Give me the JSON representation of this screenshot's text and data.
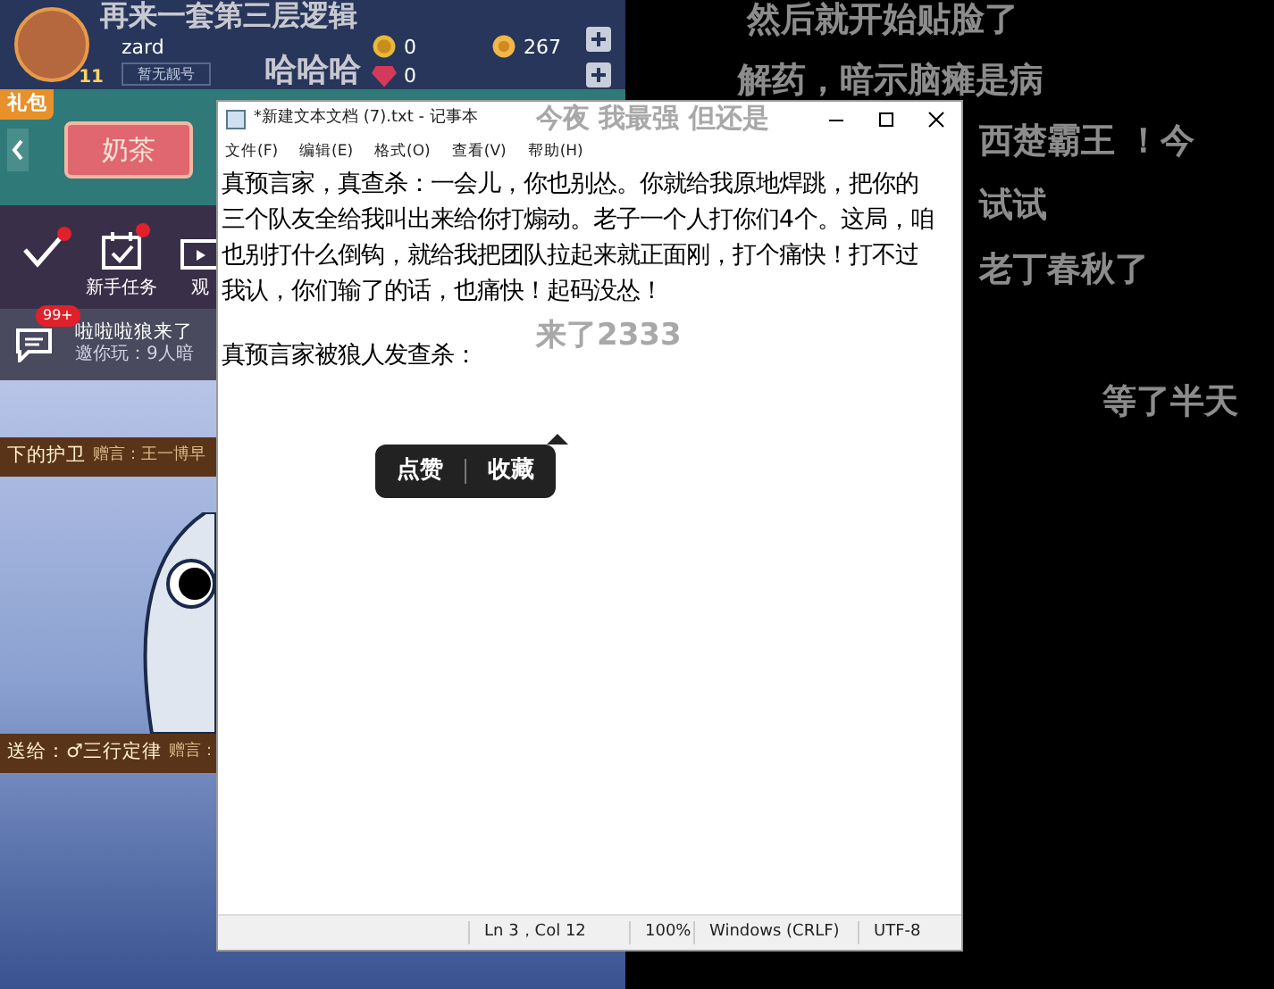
{
  "profile": {
    "username": "zard",
    "level": "11",
    "badge": "暂无靓号",
    "stats": [
      {
        "kind": "medal",
        "value": "0"
      },
      {
        "kind": "coin",
        "value": "267"
      },
      {
        "kind": "gem",
        "value": "0"
      }
    ]
  },
  "gift_pack": {
    "tag": "礼包",
    "item": "奶茶"
  },
  "shortcuts": [
    {
      "kind": "check",
      "dot": true
    },
    {
      "kind": "tasks",
      "label": "新手任务",
      "dot": true
    },
    {
      "kind": "watch",
      "label": "观",
      "dot": false
    }
  ],
  "chat": {
    "badge": "99+",
    "title": "啦啦啦狼来了",
    "subtitle": "邀你玩：9人暗"
  },
  "banners": [
    {
      "text": "下的护卫",
      "note": "赠言：王一博早"
    },
    {
      "text": "送给：♂三行定律",
      "note": "赠言："
    }
  ],
  "notepad": {
    "title": "*新建文本文档 (7).txt - 记事本",
    "menu": [
      "文件(F)",
      "编辑(E)",
      "格式(O)",
      "查看(V)",
      "帮助(H)"
    ],
    "paragraphs": [
      "真预言家，真查杀：一会儿，你也别怂。你就给我原地焊跳，把你的三个队友全给我叫出来给你打煽动。老子一个人打你们4个。这局，咱也别打什么倒钩，就给我把团队拉起来就正面刚，打个痛快！打不过我认，你们输了的话，也痛快！起码没怂！",
      "真预言家被狼人发查杀："
    ],
    "popup": [
      "点赞",
      "收藏"
    ],
    "status": [
      "Ln 3，Col 12",
      "100%",
      "Windows (CRLF)",
      "UTF-8"
    ]
  },
  "danmaku": [
    {
      "text": "再来一套第三层逻辑"
    },
    {
      "text": "哈哈哈"
    },
    {
      "text": "然后就开始贴脸了"
    },
    {
      "text": "解药，暗示脑瘫是病"
    },
    {
      "text": "今夜 我最强 但还是"
    },
    {
      "text": "西楚霸王 ！今"
    },
    {
      "text": "试试"
    },
    {
      "text": "老丁春秋了"
    },
    {
      "text": "来了2333"
    },
    {
      "text": "等了半天"
    }
  ]
}
